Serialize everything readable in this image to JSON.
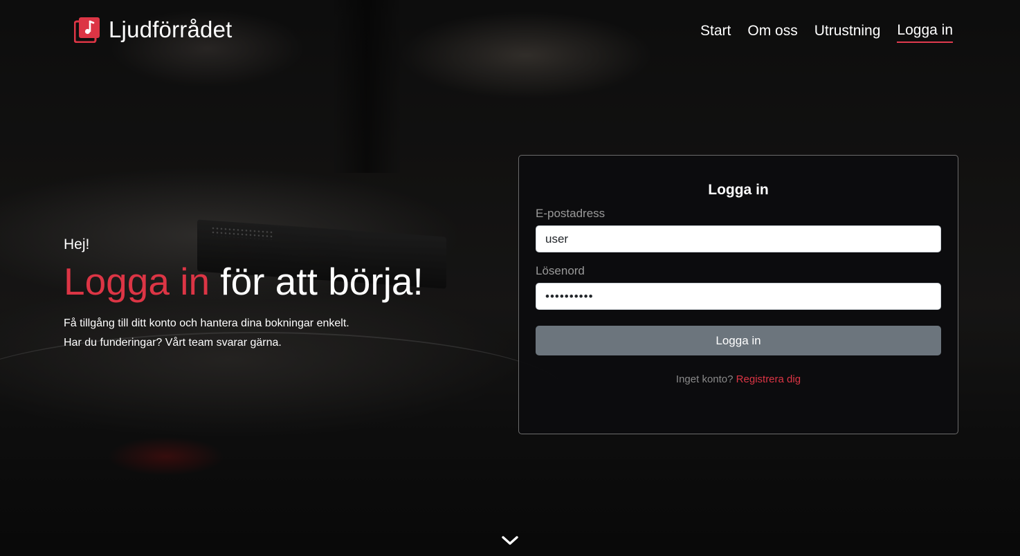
{
  "brand": {
    "name": "Ljudförrådet",
    "icon": "music-note-icon",
    "accent_color": "#dc3545"
  },
  "nav": {
    "items": [
      {
        "label": "Start"
      },
      {
        "label": "Om oss"
      },
      {
        "label": "Utrustning"
      },
      {
        "label": "Logga in",
        "active": true
      }
    ]
  },
  "hero": {
    "greeting": "Hej!",
    "headline_accent": "Logga in",
    "headline_rest": " för att börja!",
    "line1": "Få tillgång till ditt konto och hantera dina bokningar enkelt.",
    "line2": "Har du funderingar? Vårt team svarar gärna."
  },
  "login": {
    "title": "Logga in",
    "email_label": "E-postadress",
    "email_value": "user",
    "password_label": "Lösenord",
    "password_value": "••••••••••",
    "submit_label": "Logga in",
    "no_account_text": "Inget konto?",
    "register_link": "Registrera dig",
    "button_color": "#6c757d"
  },
  "scroll_indicator": {
    "icon": "chevron-down-icon"
  }
}
